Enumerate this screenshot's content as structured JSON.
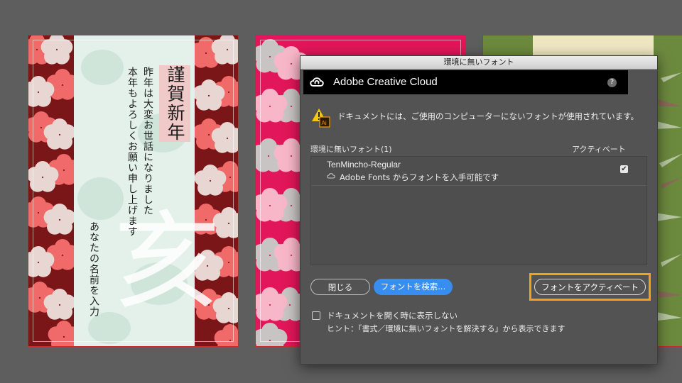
{
  "dialog": {
    "title": "環境に無いフォント",
    "brand": "Adobe Creative Cloud",
    "help_icon": "?",
    "warning_icon": "warning-ai-icon",
    "warning_message": "ドキュメントには、ご使用のコンピューターにないフォントが使用されています。",
    "list_header": "環境に無いフォント(1)",
    "activate_column": "アクティベート",
    "fonts": [
      {
        "name": "TenMincho-Regular",
        "source": "Adobe Fonts からフォントを入手可能です",
        "checked": true
      }
    ],
    "buttons": {
      "close": "閉じる",
      "find": "フォントを検索...",
      "activate": "フォントをアクティベート"
    },
    "dont_show_label": "ドキュメントを開く時に表示しない",
    "hint": "ヒント：「書式／環境に無いフォントを解決する」から表示できます",
    "accent_color": "#378ef0",
    "highlight_color": "#f5a01a"
  },
  "artboard1": {
    "title": "謹賀新年",
    "line1": "昨年は大変お世話になりました",
    "line2": "本年もよろしくお願い申し上げます",
    "name_placeholder": "あなたの名前を入力",
    "big_char": "亥"
  }
}
